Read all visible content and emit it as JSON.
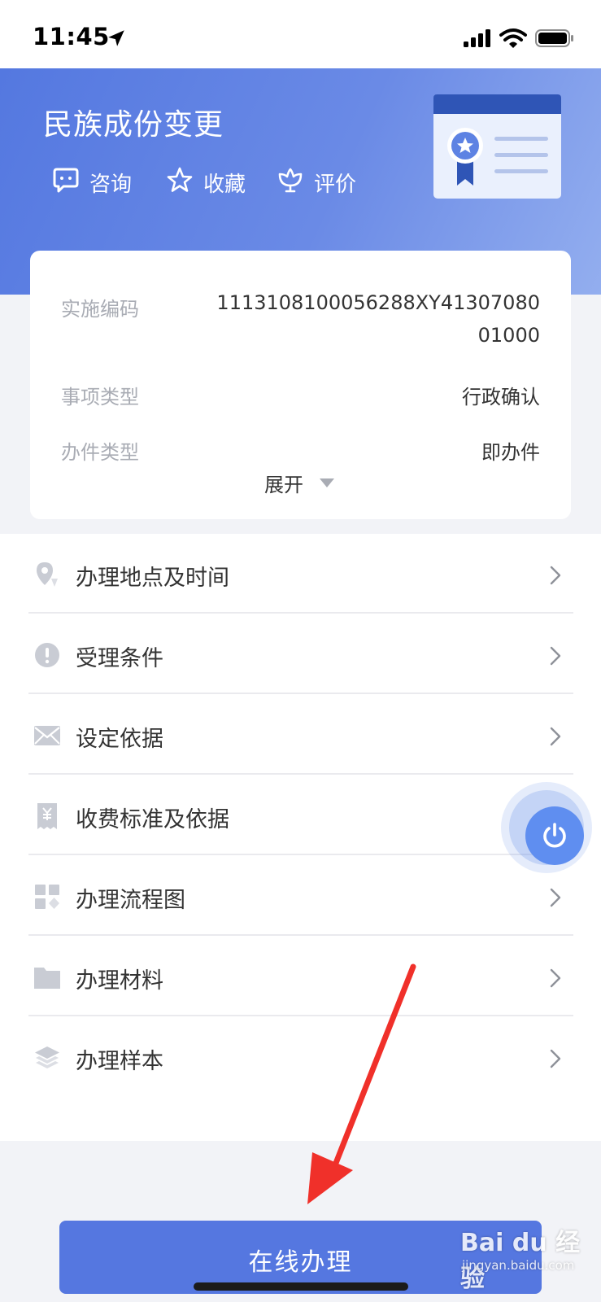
{
  "status_bar": {
    "time": "11:45"
  },
  "header": {
    "title": "民族成份变更",
    "actions": [
      {
        "label": "咨询",
        "icon": "chat-icon"
      },
      {
        "label": "收藏",
        "icon": "star-icon"
      },
      {
        "label": "评价",
        "icon": "flower-icon"
      }
    ],
    "illustration": "certificate-icon"
  },
  "info_card": {
    "rows": [
      {
        "label": "实施编码",
        "value_line1": "1113108100056288XY41307080",
        "value_line2": "01000"
      },
      {
        "label": "事项类型",
        "value": "行政确认"
      },
      {
        "label": "办件类型",
        "value": "即办件"
      }
    ],
    "expand_label": "展开"
  },
  "menu": {
    "items": [
      {
        "label": "办理地点及时间",
        "icon": "location-icon"
      },
      {
        "label": "受理条件",
        "icon": "exclamation-icon"
      },
      {
        "label": "设定依据",
        "icon": "envelope-icon"
      },
      {
        "label": "收费标准及依据",
        "icon": "receipt-icon"
      },
      {
        "label": "办理流程图",
        "icon": "flowchart-icon"
      },
      {
        "label": "办理材料",
        "icon": "folder-icon"
      },
      {
        "label": "办理样本",
        "icon": "layers-icon"
      }
    ]
  },
  "floating_button": {
    "icon": "power-icon"
  },
  "bottom": {
    "online_button": "在线办理"
  },
  "watermark": {
    "logo": "Bai du 经验",
    "site": "jingyan.baidu.com"
  },
  "colors": {
    "brand_blue": "#5577e0",
    "header_gradient_start": "#5478e0",
    "header_gradient_end": "#93aeef",
    "arrow_red": "#f0302a"
  }
}
